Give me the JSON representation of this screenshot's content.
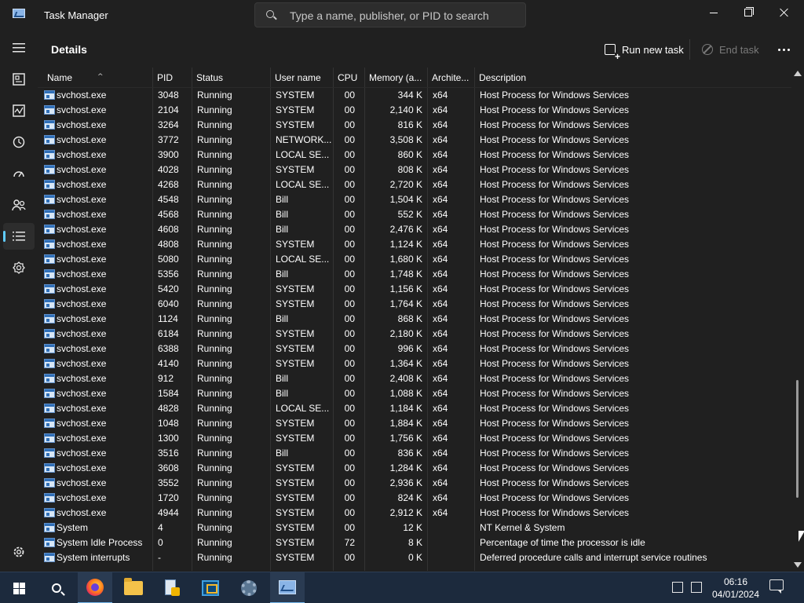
{
  "window": {
    "title": "Task Manager",
    "search_placeholder": "Type a name, publisher, or PID to search"
  },
  "page": {
    "title": "Details",
    "run_new_task": "Run new task",
    "end_task": "End task"
  },
  "columns": {
    "name": "Name",
    "pid": "PID",
    "status": "Status",
    "user": "User name",
    "cpu": "CPU",
    "memory": "Memory (a...",
    "arch": "Archite...",
    "description": "Description"
  },
  "rows": [
    {
      "name": "svchost.exe",
      "pid": "3048",
      "status": "Running",
      "user": "SYSTEM",
      "cpu": "00",
      "memory": "344 K",
      "arch": "x64",
      "description": "Host Process for Windows Services"
    },
    {
      "name": "svchost.exe",
      "pid": "2104",
      "status": "Running",
      "user": "SYSTEM",
      "cpu": "00",
      "memory": "2,140 K",
      "arch": "x64",
      "description": "Host Process for Windows Services"
    },
    {
      "name": "svchost.exe",
      "pid": "3264",
      "status": "Running",
      "user": "SYSTEM",
      "cpu": "00",
      "memory": "816 K",
      "arch": "x64",
      "description": "Host Process for Windows Services"
    },
    {
      "name": "svchost.exe",
      "pid": "3772",
      "status": "Running",
      "user": "NETWORK...",
      "cpu": "00",
      "memory": "3,508 K",
      "arch": "x64",
      "description": "Host Process for Windows Services"
    },
    {
      "name": "svchost.exe",
      "pid": "3900",
      "status": "Running",
      "user": "LOCAL SE...",
      "cpu": "00",
      "memory": "860 K",
      "arch": "x64",
      "description": "Host Process for Windows Services"
    },
    {
      "name": "svchost.exe",
      "pid": "4028",
      "status": "Running",
      "user": "SYSTEM",
      "cpu": "00",
      "memory": "808 K",
      "arch": "x64",
      "description": "Host Process for Windows Services"
    },
    {
      "name": "svchost.exe",
      "pid": "4268",
      "status": "Running",
      "user": "LOCAL SE...",
      "cpu": "00",
      "memory": "2,720 K",
      "arch": "x64",
      "description": "Host Process for Windows Services"
    },
    {
      "name": "svchost.exe",
      "pid": "4548",
      "status": "Running",
      "user": "Bill",
      "cpu": "00",
      "memory": "1,504 K",
      "arch": "x64",
      "description": "Host Process for Windows Services"
    },
    {
      "name": "svchost.exe",
      "pid": "4568",
      "status": "Running",
      "user": "Bill",
      "cpu": "00",
      "memory": "552 K",
      "arch": "x64",
      "description": "Host Process for Windows Services"
    },
    {
      "name": "svchost.exe",
      "pid": "4608",
      "status": "Running",
      "user": "Bill",
      "cpu": "00",
      "memory": "2,476 K",
      "arch": "x64",
      "description": "Host Process for Windows Services"
    },
    {
      "name": "svchost.exe",
      "pid": "4808",
      "status": "Running",
      "user": "SYSTEM",
      "cpu": "00",
      "memory": "1,124 K",
      "arch": "x64",
      "description": "Host Process for Windows Services"
    },
    {
      "name": "svchost.exe",
      "pid": "5080",
      "status": "Running",
      "user": "LOCAL SE...",
      "cpu": "00",
      "memory": "1,680 K",
      "arch": "x64",
      "description": "Host Process for Windows Services"
    },
    {
      "name": "svchost.exe",
      "pid": "5356",
      "status": "Running",
      "user": "Bill",
      "cpu": "00",
      "memory": "1,748 K",
      "arch": "x64",
      "description": "Host Process for Windows Services"
    },
    {
      "name": "svchost.exe",
      "pid": "5420",
      "status": "Running",
      "user": "SYSTEM",
      "cpu": "00",
      "memory": "1,156 K",
      "arch": "x64",
      "description": "Host Process for Windows Services"
    },
    {
      "name": "svchost.exe",
      "pid": "6040",
      "status": "Running",
      "user": "SYSTEM",
      "cpu": "00",
      "memory": "1,764 K",
      "arch": "x64",
      "description": "Host Process for Windows Services"
    },
    {
      "name": "svchost.exe",
      "pid": "1124",
      "status": "Running",
      "user": "Bill",
      "cpu": "00",
      "memory": "868 K",
      "arch": "x64",
      "description": "Host Process for Windows Services"
    },
    {
      "name": "svchost.exe",
      "pid": "6184",
      "status": "Running",
      "user": "SYSTEM",
      "cpu": "00",
      "memory": "2,180 K",
      "arch": "x64",
      "description": "Host Process for Windows Services"
    },
    {
      "name": "svchost.exe",
      "pid": "6388",
      "status": "Running",
      "user": "SYSTEM",
      "cpu": "00",
      "memory": "996 K",
      "arch": "x64",
      "description": "Host Process for Windows Services"
    },
    {
      "name": "svchost.exe",
      "pid": "4140",
      "status": "Running",
      "user": "SYSTEM",
      "cpu": "00",
      "memory": "1,364 K",
      "arch": "x64",
      "description": "Host Process for Windows Services"
    },
    {
      "name": "svchost.exe",
      "pid": "912",
      "status": "Running",
      "user": "Bill",
      "cpu": "00",
      "memory": "2,408 K",
      "arch": "x64",
      "description": "Host Process for Windows Services"
    },
    {
      "name": "svchost.exe",
      "pid": "1584",
      "status": "Running",
      "user": "Bill",
      "cpu": "00",
      "memory": "1,088 K",
      "arch": "x64",
      "description": "Host Process for Windows Services"
    },
    {
      "name": "svchost.exe",
      "pid": "4828",
      "status": "Running",
      "user": "LOCAL SE...",
      "cpu": "00",
      "memory": "1,184 K",
      "arch": "x64",
      "description": "Host Process for Windows Services"
    },
    {
      "name": "svchost.exe",
      "pid": "1048",
      "status": "Running",
      "user": "SYSTEM",
      "cpu": "00",
      "memory": "1,884 K",
      "arch": "x64",
      "description": "Host Process for Windows Services"
    },
    {
      "name": "svchost.exe",
      "pid": "1300",
      "status": "Running",
      "user": "SYSTEM",
      "cpu": "00",
      "memory": "1,756 K",
      "arch": "x64",
      "description": "Host Process for Windows Services"
    },
    {
      "name": "svchost.exe",
      "pid": "3516",
      "status": "Running",
      "user": "Bill",
      "cpu": "00",
      "memory": "836 K",
      "arch": "x64",
      "description": "Host Process for Windows Services"
    },
    {
      "name": "svchost.exe",
      "pid": "3608",
      "status": "Running",
      "user": "SYSTEM",
      "cpu": "00",
      "memory": "1,284 K",
      "arch": "x64",
      "description": "Host Process for Windows Services"
    },
    {
      "name": "svchost.exe",
      "pid": "3552",
      "status": "Running",
      "user": "SYSTEM",
      "cpu": "00",
      "memory": "2,936 K",
      "arch": "x64",
      "description": "Host Process for Windows Services"
    },
    {
      "name": "svchost.exe",
      "pid": "1720",
      "status": "Running",
      "user": "SYSTEM",
      "cpu": "00",
      "memory": "824 K",
      "arch": "x64",
      "description": "Host Process for Windows Services"
    },
    {
      "name": "svchost.exe",
      "pid": "4944",
      "status": "Running",
      "user": "SYSTEM",
      "cpu": "00",
      "memory": "2,912 K",
      "arch": "x64",
      "description": "Host Process for Windows Services"
    },
    {
      "name": "System",
      "pid": "4",
      "status": "Running",
      "user": "SYSTEM",
      "cpu": "00",
      "memory": "12 K",
      "arch": "",
      "description": "NT Kernel & System"
    },
    {
      "name": "System Idle Process",
      "pid": "0",
      "status": "Running",
      "user": "SYSTEM",
      "cpu": "72",
      "memory": "8 K",
      "arch": "",
      "description": "Percentage of time the processor is idle"
    },
    {
      "name": "System interrupts",
      "pid": "-",
      "status": "Running",
      "user": "SYSTEM",
      "cpu": "00",
      "memory": "0 K",
      "arch": "",
      "description": "Deferred procedure calls and interrupt service routines"
    }
  ],
  "taskbar": {
    "time": "06:16",
    "date": "04/01/2024"
  },
  "icons": {
    "nav": [
      "hamburger-icon",
      "processes-icon",
      "performance-icon",
      "app-history-icon",
      "startup-apps-icon",
      "users-icon",
      "details-icon",
      "services-icon",
      "settings-icon"
    ],
    "taskbar": [
      "windows-logo-icon",
      "search-icon",
      "firefox-icon",
      "file-explorer-icon",
      "server-manager-icon",
      "remote-desktop-icon",
      "settings-gear-icon",
      "task-manager-icon"
    ]
  },
  "colors": {
    "background": "#202020",
    "accent": "#60cdff",
    "taskbar": "#1c2a3d"
  }
}
